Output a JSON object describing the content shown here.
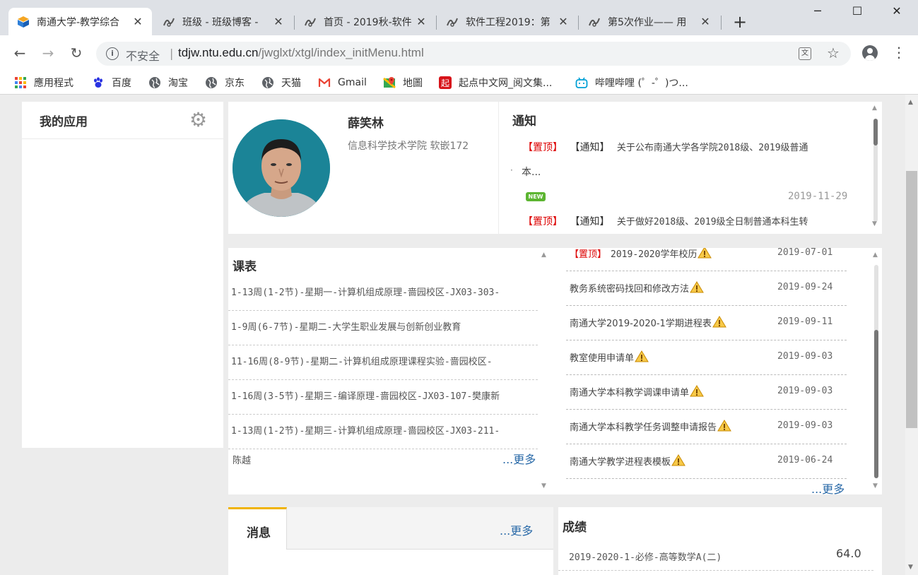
{
  "browser": {
    "tabs": [
      {
        "title": "南通大学-教学综合",
        "icon": "ntu-icon",
        "active": true
      },
      {
        "title": "班级 - 班级博客 -",
        "icon": "cnblogs-icon"
      },
      {
        "title": "首页 - 2019秋-软件",
        "icon": "cnblogs-icon"
      },
      {
        "title": "软件工程2019：第",
        "icon": "cnblogs-icon"
      },
      {
        "title": "第5次作业—— 用",
        "icon": "cnblogs-icon"
      }
    ],
    "close_glyph": "✕",
    "new_tab_glyph": "+",
    "window_controls": {
      "minimize": "─",
      "maximize": "☐",
      "close": "✕"
    },
    "nav": {
      "back": "←",
      "forward": "→",
      "reload": "↻"
    },
    "omnibox": {
      "info_glyph": "i",
      "security_label": "不安全",
      "separator": "|",
      "url_host": "tdjw.ntu.edu.cn",
      "url_path": "/jwglxt/xtgl/index_initMenu.html"
    },
    "star_glyph": "☆",
    "menu_glyph": "⋮",
    "translate_glyph": "文",
    "bookmarks": [
      {
        "label": "應用程式",
        "icon": "apps-grid-icon"
      },
      {
        "label": "百度",
        "icon": "baidu-paw-icon"
      },
      {
        "label": "淘宝",
        "icon": "globe-icon"
      },
      {
        "label": "京东",
        "icon": "globe-icon"
      },
      {
        "label": "天猫",
        "icon": "globe-icon"
      },
      {
        "label": "Gmail",
        "icon": "gmail-icon"
      },
      {
        "label": "地圖",
        "icon": "maps-pin-icon"
      },
      {
        "label": "起点中文网_阅文集...",
        "icon": "qidian-icon",
        "glyph": "起"
      },
      {
        "label": "哔哩哔哩 (゜-゜)つ...",
        "icon": "bilibili-icon"
      }
    ],
    "colors": {
      "tabstrip": "#dee1e6",
      "accent_red": "#d00000",
      "link_blue": "#2a6aa8",
      "tab_accent": "#f0b400"
    }
  },
  "apps": {
    "title": "我的应用",
    "gear_glyph": "⚙"
  },
  "profile": {
    "name": "薛笑林",
    "department": "信息科学技术学院 软嵌172"
  },
  "notices": {
    "title": "通知",
    "items": [
      {
        "pin": "【置顶】",
        "tag": "【通知】",
        "text": "关于公布南通大学各学院2018级、2019级普通",
        "text2": "本...",
        "bullet": "·",
        "badge": "NEW",
        "date": "2019-11-29"
      },
      {
        "pin": "【置顶】",
        "tag": "【通知】",
        "text": "关于做好2018级、2019级全日制普通本科生转"
      }
    ]
  },
  "courses": {
    "title": "课表",
    "items": [
      "1-13周(1-2节)-星期一-计算机组成原理-啬园校区-JX03-303-",
      "1-9周(6-7节)-星期二-大学生职业发展与创新创业教育",
      "11-16周(8-9节)-星期二-计算机组成原理课程实验-啬园校区-",
      "1-16周(3-5节)-星期三-编译原理-啬园校区-JX03-107-樊康新",
      "1-13周(1-2节)-星期三-计算机组成原理-啬园校区-JX03-211-"
    ],
    "trailing_text": "陈越",
    "more_label": "...更多"
  },
  "files": {
    "items": [
      {
        "pin": "【置顶】",
        "title": "2019-2020学年校历",
        "date": "2019-07-01",
        "pinned": true
      },
      {
        "title": "教务系统密码找回和修改方法",
        "date": "2019-09-24"
      },
      {
        "title": "南通大学2019-2020-1学期进程表",
        "date": "2019-09-11"
      },
      {
        "title": "教室使用申请单",
        "date": "2019-09-03"
      },
      {
        "title": "南通大学本科教学调课申请单",
        "date": "2019-09-03"
      },
      {
        "title": "南通大学本科教学任务调整申请报告",
        "date": "2019-09-03"
      },
      {
        "title": "南通大学教学进程表模板",
        "date": "2019-06-24"
      }
    ],
    "more_label": "...更多",
    "warn_icon": "warning-triangle-icon"
  },
  "messages": {
    "tab_label": "消息",
    "more_label": "...更多"
  },
  "grades": {
    "title": "成绩",
    "items": [
      {
        "course": "2019-2020-1-必修-高等数学A(二)",
        "score": "64.0"
      }
    ]
  },
  "scroll": {
    "up": "▲",
    "down": "▼"
  }
}
